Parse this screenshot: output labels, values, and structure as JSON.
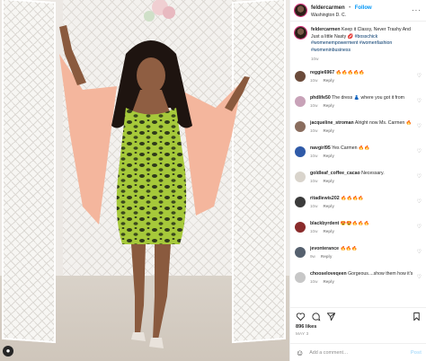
{
  "post": {
    "username": "feldercarmen",
    "separator": "•",
    "follow_label": "Follow",
    "location": "Washington D. C.",
    "more_label": "···"
  },
  "caption": {
    "username": "feldercarmen",
    "text": "Keep it Classy, Never Trashy And Just a little Nasty 💋",
    "hashtags": "#bosschick #womenempowerment #womenfashion #womeninbusiness",
    "time": "10w"
  },
  "comments": [
    {
      "username": "reggie6967",
      "text": "🔥🔥🔥🔥🔥",
      "time": "10w",
      "reply": "Reply",
      "color": "#6b4b3a"
    },
    {
      "username": "phdlife50",
      "text": "The dress 👗 where you got it from",
      "time": "10w",
      "reply": "Reply",
      "color": "#c8a2b8"
    },
    {
      "username": "jacqueline_stroman",
      "text": "Alright now Ms. Carmen 🔥",
      "time": "10w",
      "reply": "Reply",
      "color": "#8a6d5e"
    },
    {
      "username": "navgirl95",
      "text": "Yes Carmen 🔥🔥",
      "time": "10w",
      "reply": "Reply",
      "color": "#2f5aa8"
    },
    {
      "username": "goldleaf_coffee_cacao",
      "text": "Necessary.",
      "time": "10w",
      "reply": "Reply",
      "color": "#d9d4cc"
    },
    {
      "username": "ritadlewis202",
      "text": "🔥🔥🔥🔥",
      "time": "10w",
      "reply": "Reply",
      "color": "#3b3b3b"
    },
    {
      "username": "blackbyrdent",
      "text": "😍😍🔥🔥🔥",
      "time": "10w",
      "reply": "Reply",
      "color": "#8a2b2b"
    },
    {
      "username": "jevonterance",
      "text": "🔥🔥🔥",
      "time": "9w",
      "reply": "Reply",
      "color": "#55606e"
    },
    {
      "username": "chooseloveqeen",
      "text": "Gorgeous....show them how it's done 😍❤️❤️🔥🔥",
      "time": "10w",
      "reply": "Reply",
      "color": "#c7c7c7"
    }
  ],
  "footer": {
    "likes": "896 likes",
    "date": "MAY 3",
    "add_comment_placeholder": "Add a comment…",
    "post_label": "Post"
  },
  "icons": {
    "like": "heart-icon",
    "comment": "comment-icon",
    "share": "share-icon",
    "save": "bookmark-icon",
    "emoji": "smile-icon",
    "photo_badge": "user-tag-icon"
  }
}
